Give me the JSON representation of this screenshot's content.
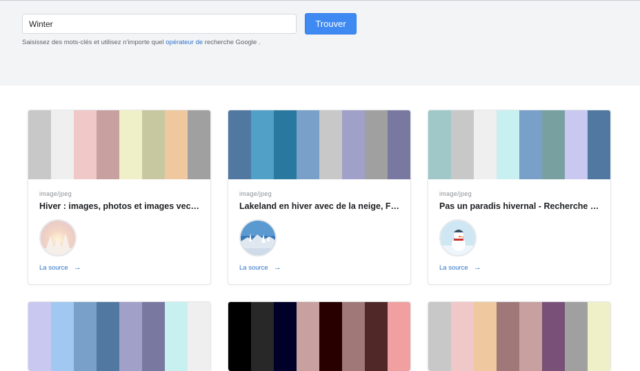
{
  "search": {
    "value": "Winter",
    "button_label": "Trouver",
    "hint_before": "Saisissez des mots-clés et utilisez n'importe quel ",
    "hint_link": "opérateur de",
    "hint_after": " recherche Google ."
  },
  "cards": [
    {
      "mime": "image/jpeg",
      "title": "Hiver : images, photos et images vectorielles",
      "source_label": "La source",
      "palette": [
        "#c8c8c8",
        "#efefef",
        "#f0c8c8",
        "#c8a0a0",
        "#f0f0c8",
        "#c8c8a0",
        "#f0c8a0",
        "#a0a0a0"
      ]
    },
    {
      "mime": "image/jpeg",
      "title": "Lakeland en hiver avec de la neige, Finlande",
      "source_label": "La source",
      "palette": [
        "#5078a0",
        "#50a0c8",
        "#2878a0",
        "#78a0c8",
        "#c8c8c8",
        "#a0a0c8",
        "#a0a0a0",
        "#7878a0"
      ]
    },
    {
      "mime": "image/jpeg",
      "title": "Pas un paradis hivernal - Recherche sur Google",
      "source_label": "La source",
      "palette": [
        "#a0c8c8",
        "#c8c8c8",
        "#efefef",
        "#c8f0f0",
        "#78a0c8",
        "#78a0a0",
        "#c8c8f0",
        "#5078a0"
      ]
    },
    {
      "palette": [
        "#c8c8f0",
        "#a0c8f0",
        "#78a0c8",
        "#5078a0",
        "#a0a0c8",
        "#7878a0",
        "#c8f0f0",
        "#efefef"
      ]
    },
    {
      "palette": [
        "#000000",
        "#282828",
        "#000028",
        "#c8a0a0",
        "#280000",
        "#a07878",
        "#502828",
        "#f0a0a0"
      ]
    },
    {
      "palette": [
        "#c8c8c8",
        "#f0c8c8",
        "#f0c8a0",
        "#a07878",
        "#c8a0a0",
        "#785078",
        "#a0a0a0",
        "#f0f0c8"
      ]
    }
  ]
}
